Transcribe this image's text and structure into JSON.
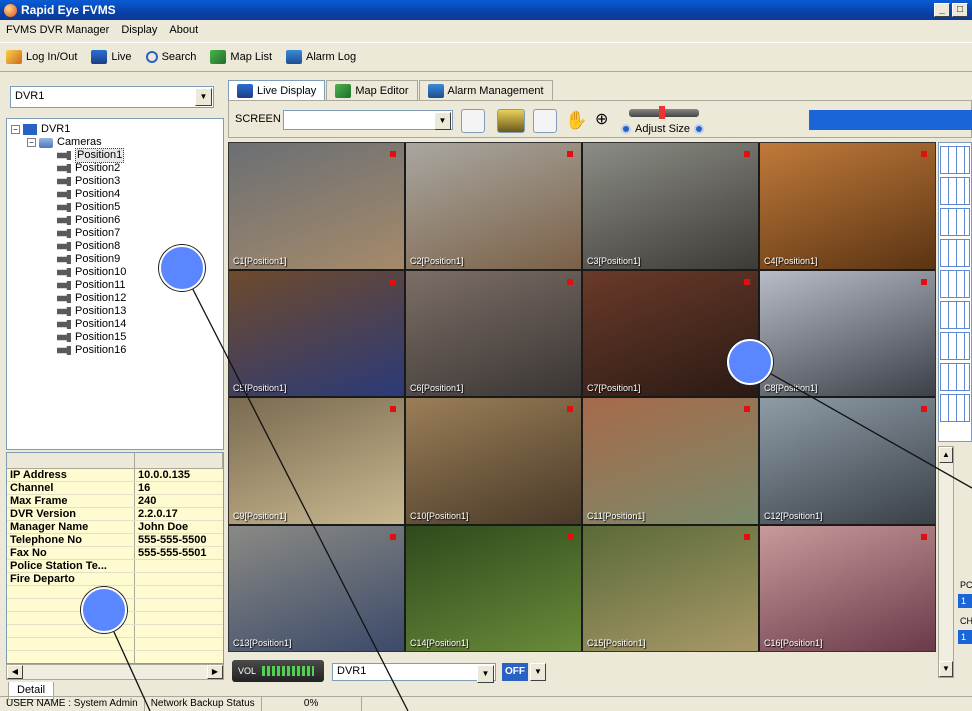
{
  "window": {
    "title": "Rapid Eye FVMS",
    "controls": [
      "_",
      "□"
    ]
  },
  "menu": [
    "FVMS DVR Manager",
    "Display",
    "About"
  ],
  "toolbar": [
    {
      "label": "Log In/Out",
      "icon": "login-icon"
    },
    {
      "label": "Live",
      "icon": "live-icon"
    },
    {
      "label": "Search",
      "icon": "search-icon"
    },
    {
      "label": "Map List",
      "icon": "map-icon"
    },
    {
      "label": "Alarm Log",
      "icon": "alarm-icon"
    }
  ],
  "left_panel": {
    "dvr_select": "DVR1",
    "tree": {
      "root": "DVR1",
      "folder": "Cameras",
      "cameras": [
        "Position1",
        "Position2",
        "Position3",
        "Position4",
        "Position5",
        "Position6",
        "Position7",
        "Position8",
        "Position9",
        "Position10",
        "Position11",
        "Position12",
        "Position13",
        "Position14",
        "Position15",
        "Position16"
      ]
    },
    "properties": [
      {
        "key": "IP Address",
        "value": "10.0.0.135"
      },
      {
        "key": "Channel",
        "value": "16"
      },
      {
        "key": "Max Frame",
        "value": "240"
      },
      {
        "key": "DVR Version",
        "value": "2.2.0.17"
      },
      {
        "key": "Manager Name",
        "value": "John Doe"
      },
      {
        "key": "Telephone No",
        "value": "555-555-5500"
      },
      {
        "key": "Fax No",
        "value": "555-555-5501"
      },
      {
        "key": "Police Station Te...",
        "value": ""
      },
      {
        "key": "Fire Departo",
        "value": ""
      }
    ],
    "detail_tab": "Detail"
  },
  "tabs": [
    "Live Display",
    "Map Editor",
    "Alarm Management"
  ],
  "screen_bar": {
    "label": "SCREEN",
    "adjust_label": "Adjust Size"
  },
  "cameras": [
    {
      "label": "C1[Position1]",
      "colors": [
        "#6b6f74",
        "#a58a6a"
      ]
    },
    {
      "label": "C2[Position1]",
      "colors": [
        "#a9a7a0",
        "#7b6148"
      ]
    },
    {
      "label": "C3[Position1]",
      "colors": [
        "#8c8d86",
        "#3e3b36"
      ]
    },
    {
      "label": "C4[Position1]",
      "colors": [
        "#c07a3a",
        "#5b3413"
      ]
    },
    {
      "label": "C5[Position1]",
      "colors": [
        "#6e4a2c",
        "#2b3a78"
      ]
    },
    {
      "label": "C6[Position1]",
      "colors": [
        "#7c6e66",
        "#3a3634"
      ]
    },
    {
      "label": "C7[Position1]",
      "colors": [
        "#6a3a2a",
        "#2a1a14"
      ]
    },
    {
      "label": "C8[Position1]",
      "colors": [
        "#b8bcc6",
        "#3c4048"
      ]
    },
    {
      "label": "C9[Position1]",
      "colors": [
        "#7a6a50",
        "#c8b890"
      ]
    },
    {
      "label": "C10[Position1]",
      "colors": [
        "#9a7e58",
        "#4a3a28"
      ]
    },
    {
      "label": "C11[Position1]",
      "colors": [
        "#a66a4a",
        "#7a8a6a"
      ]
    },
    {
      "label": "C12[Position1]",
      "colors": [
        "#8e9ca6",
        "#3a4048"
      ]
    },
    {
      "label": "C13[Position1]",
      "colors": [
        "#8a8a84",
        "#3c4a6a"
      ]
    },
    {
      "label": "C14[Position1]",
      "colors": [
        "#2e4a1c",
        "#6a8a3a"
      ]
    },
    {
      "label": "C15[Position1]",
      "colors": [
        "#5a6a38",
        "#a89868"
      ]
    },
    {
      "label": "C16[Position1]",
      "colors": [
        "#c89a9a",
        "#6a3a4a"
      ]
    }
  ],
  "right_side": {
    "label_a": "PC",
    "value_a": "1",
    "label_b": "CH",
    "value_b": "1"
  },
  "bottom": {
    "vol_label": "VOL",
    "dvr": "DVR1",
    "off": "OFF"
  },
  "status": {
    "user": "USER NAME : System Admin",
    "backup": "Network Backup Status",
    "percent": "0%"
  }
}
